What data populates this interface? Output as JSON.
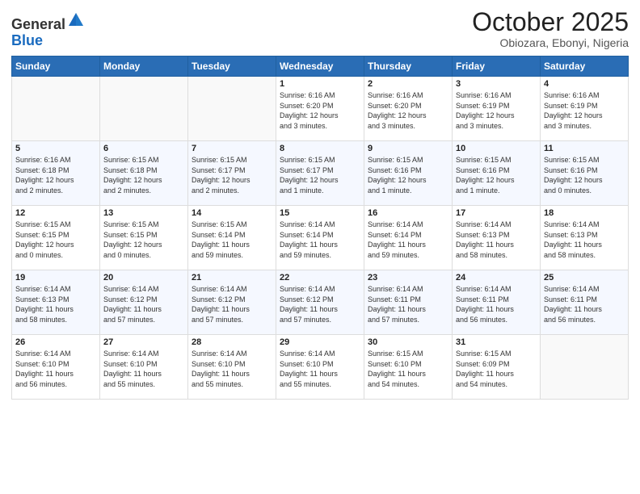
{
  "logo": {
    "general": "General",
    "blue": "Blue"
  },
  "header": {
    "month": "October 2025",
    "location": "Obiozara, Ebonyi, Nigeria"
  },
  "weekdays": [
    "Sunday",
    "Monday",
    "Tuesday",
    "Wednesday",
    "Thursday",
    "Friday",
    "Saturday"
  ],
  "weeks": [
    [
      {
        "day": "",
        "info": ""
      },
      {
        "day": "",
        "info": ""
      },
      {
        "day": "",
        "info": ""
      },
      {
        "day": "1",
        "info": "Sunrise: 6:16 AM\nSunset: 6:20 PM\nDaylight: 12 hours\nand 3 minutes."
      },
      {
        "day": "2",
        "info": "Sunrise: 6:16 AM\nSunset: 6:20 PM\nDaylight: 12 hours\nand 3 minutes."
      },
      {
        "day": "3",
        "info": "Sunrise: 6:16 AM\nSunset: 6:19 PM\nDaylight: 12 hours\nand 3 minutes."
      },
      {
        "day": "4",
        "info": "Sunrise: 6:16 AM\nSunset: 6:19 PM\nDaylight: 12 hours\nand 3 minutes."
      }
    ],
    [
      {
        "day": "5",
        "info": "Sunrise: 6:16 AM\nSunset: 6:18 PM\nDaylight: 12 hours\nand 2 minutes."
      },
      {
        "day": "6",
        "info": "Sunrise: 6:15 AM\nSunset: 6:18 PM\nDaylight: 12 hours\nand 2 minutes."
      },
      {
        "day": "7",
        "info": "Sunrise: 6:15 AM\nSunset: 6:17 PM\nDaylight: 12 hours\nand 2 minutes."
      },
      {
        "day": "8",
        "info": "Sunrise: 6:15 AM\nSunset: 6:17 PM\nDaylight: 12 hours\nand 1 minute."
      },
      {
        "day": "9",
        "info": "Sunrise: 6:15 AM\nSunset: 6:16 PM\nDaylight: 12 hours\nand 1 minute."
      },
      {
        "day": "10",
        "info": "Sunrise: 6:15 AM\nSunset: 6:16 PM\nDaylight: 12 hours\nand 1 minute."
      },
      {
        "day": "11",
        "info": "Sunrise: 6:15 AM\nSunset: 6:16 PM\nDaylight: 12 hours\nand 0 minutes."
      }
    ],
    [
      {
        "day": "12",
        "info": "Sunrise: 6:15 AM\nSunset: 6:15 PM\nDaylight: 12 hours\nand 0 minutes."
      },
      {
        "day": "13",
        "info": "Sunrise: 6:15 AM\nSunset: 6:15 PM\nDaylight: 12 hours\nand 0 minutes."
      },
      {
        "day": "14",
        "info": "Sunrise: 6:15 AM\nSunset: 6:14 PM\nDaylight: 11 hours\nand 59 minutes."
      },
      {
        "day": "15",
        "info": "Sunrise: 6:14 AM\nSunset: 6:14 PM\nDaylight: 11 hours\nand 59 minutes."
      },
      {
        "day": "16",
        "info": "Sunrise: 6:14 AM\nSunset: 6:14 PM\nDaylight: 11 hours\nand 59 minutes."
      },
      {
        "day": "17",
        "info": "Sunrise: 6:14 AM\nSunset: 6:13 PM\nDaylight: 11 hours\nand 58 minutes."
      },
      {
        "day": "18",
        "info": "Sunrise: 6:14 AM\nSunset: 6:13 PM\nDaylight: 11 hours\nand 58 minutes."
      }
    ],
    [
      {
        "day": "19",
        "info": "Sunrise: 6:14 AM\nSunset: 6:13 PM\nDaylight: 11 hours\nand 58 minutes."
      },
      {
        "day": "20",
        "info": "Sunrise: 6:14 AM\nSunset: 6:12 PM\nDaylight: 11 hours\nand 57 minutes."
      },
      {
        "day": "21",
        "info": "Sunrise: 6:14 AM\nSunset: 6:12 PM\nDaylight: 11 hours\nand 57 minutes."
      },
      {
        "day": "22",
        "info": "Sunrise: 6:14 AM\nSunset: 6:12 PM\nDaylight: 11 hours\nand 57 minutes."
      },
      {
        "day": "23",
        "info": "Sunrise: 6:14 AM\nSunset: 6:11 PM\nDaylight: 11 hours\nand 57 minutes."
      },
      {
        "day": "24",
        "info": "Sunrise: 6:14 AM\nSunset: 6:11 PM\nDaylight: 11 hours\nand 56 minutes."
      },
      {
        "day": "25",
        "info": "Sunrise: 6:14 AM\nSunset: 6:11 PM\nDaylight: 11 hours\nand 56 minutes."
      }
    ],
    [
      {
        "day": "26",
        "info": "Sunrise: 6:14 AM\nSunset: 6:10 PM\nDaylight: 11 hours\nand 56 minutes."
      },
      {
        "day": "27",
        "info": "Sunrise: 6:14 AM\nSunset: 6:10 PM\nDaylight: 11 hours\nand 55 minutes."
      },
      {
        "day": "28",
        "info": "Sunrise: 6:14 AM\nSunset: 6:10 PM\nDaylight: 11 hours\nand 55 minutes."
      },
      {
        "day": "29",
        "info": "Sunrise: 6:14 AM\nSunset: 6:10 PM\nDaylight: 11 hours\nand 55 minutes."
      },
      {
        "day": "30",
        "info": "Sunrise: 6:15 AM\nSunset: 6:10 PM\nDaylight: 11 hours\nand 54 minutes."
      },
      {
        "day": "31",
        "info": "Sunrise: 6:15 AM\nSunset: 6:09 PM\nDaylight: 11 hours\nand 54 minutes."
      },
      {
        "day": "",
        "info": ""
      }
    ]
  ]
}
